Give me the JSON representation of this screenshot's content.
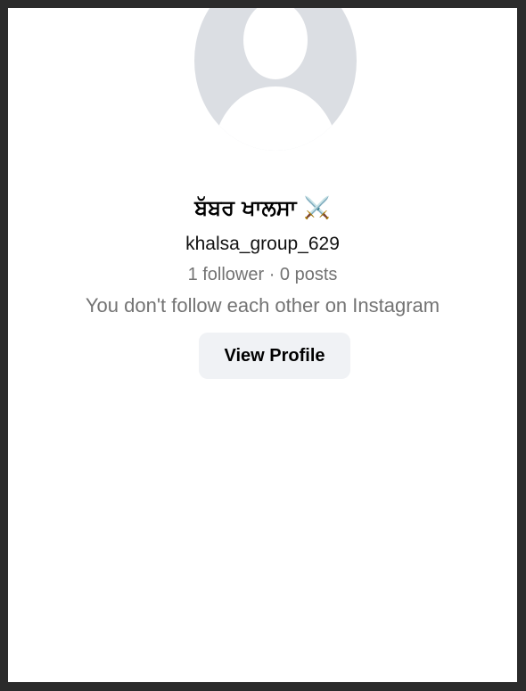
{
  "profile": {
    "display_name": "ਬੱਬਰ ਖਾਲਸਾ ⚔️",
    "username": "khalsa_group_629",
    "stats": "1 follower · 0 posts",
    "relationship": "You don't follow each other on Instagram",
    "view_profile_label": "View Profile"
  },
  "colors": {
    "avatar_bg": "#dbdee3",
    "avatar_silhouette": "#ffffff",
    "muted_text": "#737373",
    "button_bg": "#f0f2f5"
  }
}
